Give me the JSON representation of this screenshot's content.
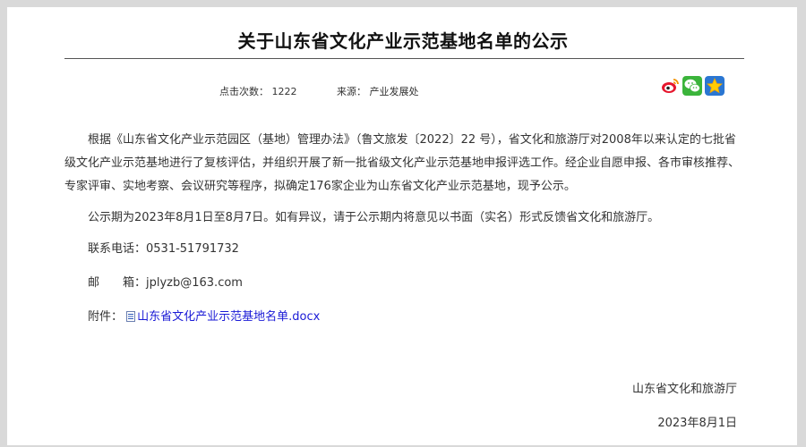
{
  "article": {
    "title": "关于山东省文化产业示范基地名单的公示",
    "meta": {
      "clicks_label": "点击次数：",
      "clicks_value": "1222",
      "source_label": "来源：",
      "source_value": "产业发展处"
    },
    "share_icons": [
      "weibo-icon",
      "wechat-icon",
      "qzone-icon"
    ],
    "paragraphs": [
      "根据《山东省文化产业示范园区（基地）管理办法》（鲁文旅发〔2022〕22 号），省文化和旅游厅对2008年以来认定的七批省级文化产业示范基地进行了复核评估，并组织开展了新一批省级文化产业示范基地申报评选工作。经企业自愿申报、各市审核推荐、专家评审、实地考察、会议研究等程序，拟确定176家企业为山东省文化产业示范基地，现予公示。",
      "公示期为2023年8月1日至8月7日。如有异议，请于公示期内将意见以书面（实名）形式反馈省文化和旅游厅。"
    ],
    "contact": {
      "phone": "联系电话：0531-51791732",
      "email": "邮　　箱：jplyzb@163.com"
    },
    "attachment": {
      "label": "附件：",
      "file_name": "山东省文化产业示范基地名单.docx"
    },
    "signer": "山东省文化和旅游厅",
    "date": "2023年8月1日"
  }
}
